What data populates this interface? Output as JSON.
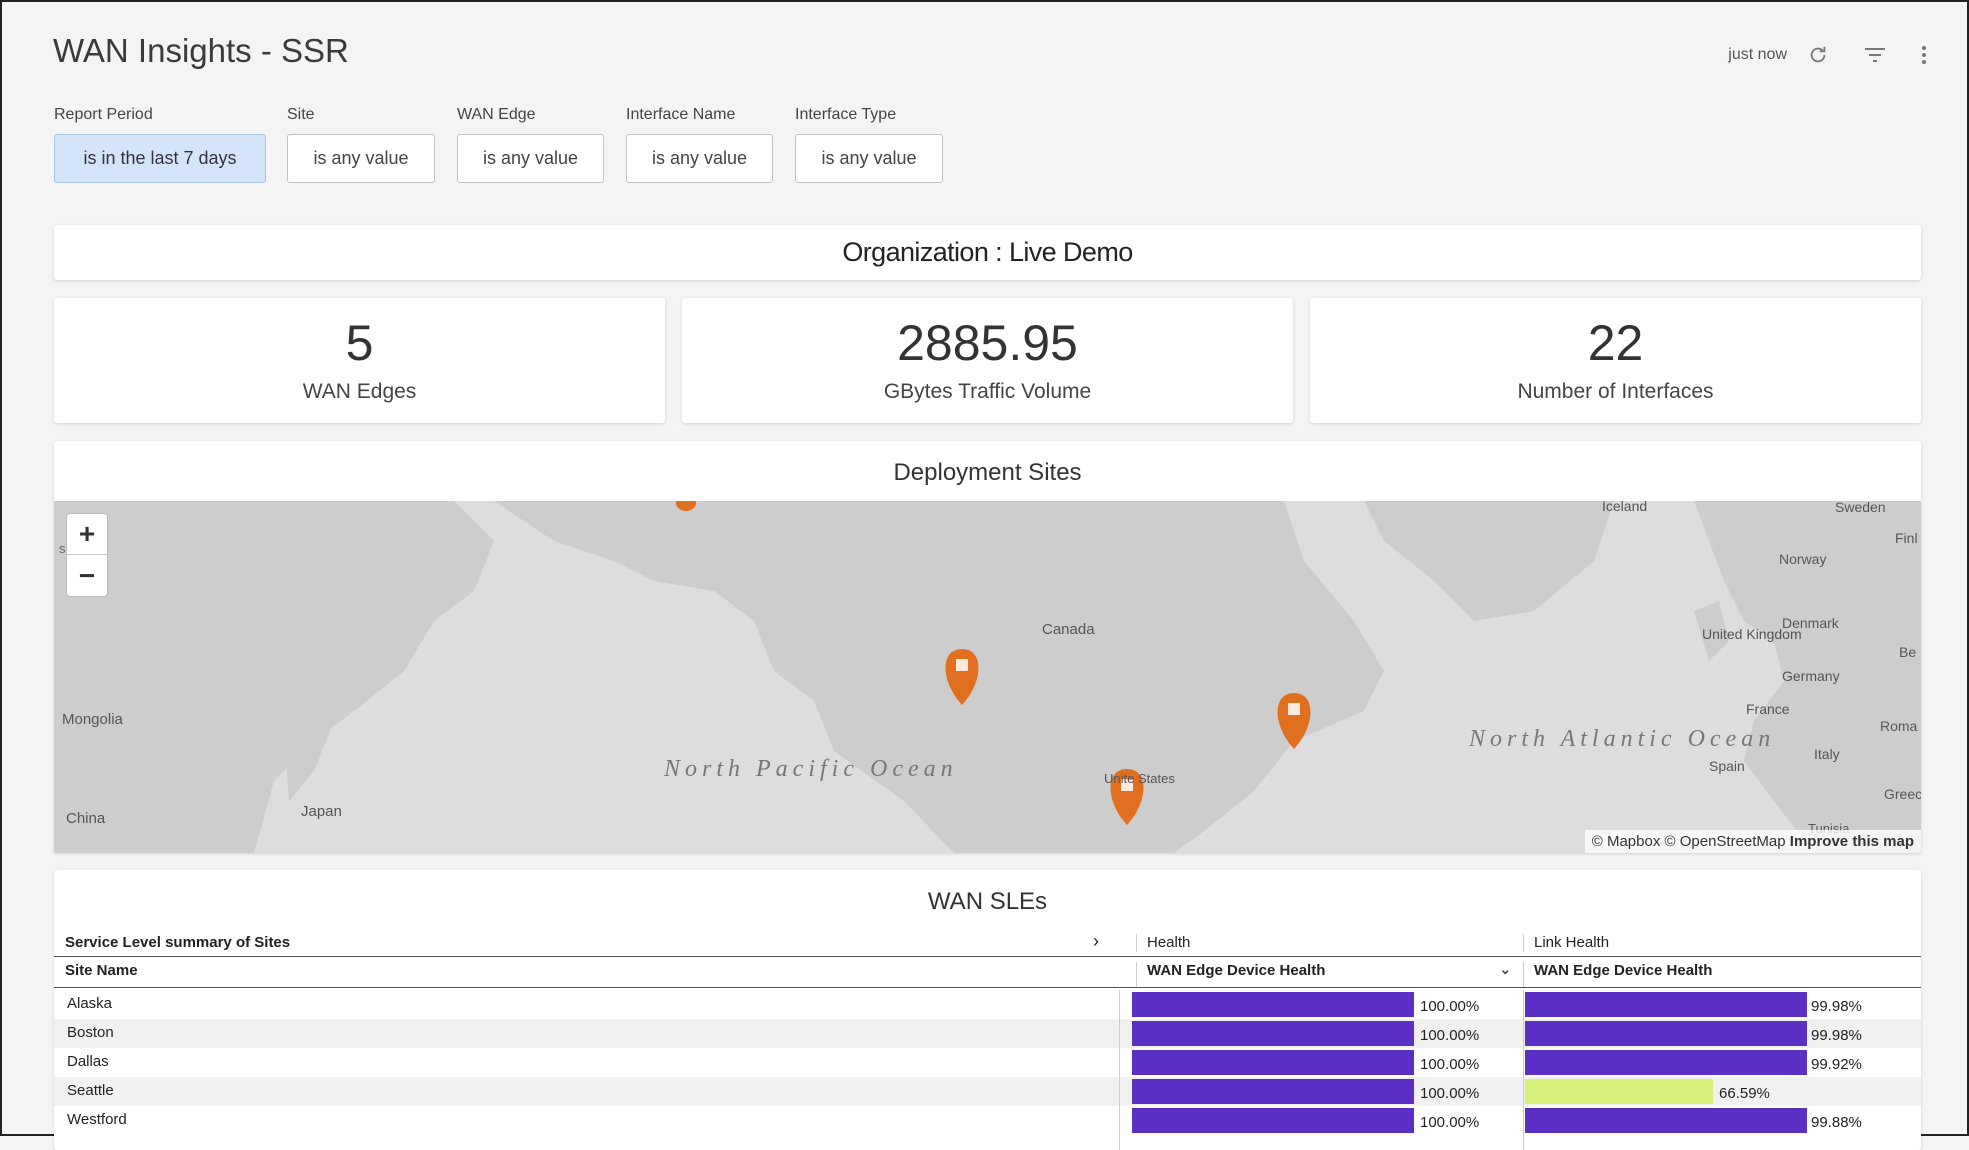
{
  "header": {
    "title": "WAN Insights - SSR",
    "timestamp": "just now"
  },
  "filters": [
    {
      "label": "Report Period",
      "value": "is in the last 7 days",
      "active": true
    },
    {
      "label": "Site",
      "value": "is any value",
      "active": false
    },
    {
      "label": "WAN Edge",
      "value": "is any value",
      "active": false
    },
    {
      "label": "Interface Name",
      "value": "is any value",
      "active": false
    },
    {
      "label": "Interface Type",
      "value": "is any value",
      "active": false
    }
  ],
  "org_banner": "Organization : Live Demo",
  "kpis": [
    {
      "value": "5",
      "label": "WAN Edges"
    },
    {
      "value": "2885.95",
      "label": "GBytes Traffic Volume"
    },
    {
      "value": "22",
      "label": "Number of Interfaces"
    }
  ],
  "map": {
    "title": "Deployment Sites",
    "zoom_in": "+",
    "zoom_out": "−",
    "attribution_text": "© Mapbox © OpenStreetMap",
    "attribution_link": "Improve this map",
    "labels": {
      "mongolia": "Mongolia",
      "china": "China",
      "japan": "Japan",
      "canada": "Canada",
      "iceland": "Iceland",
      "sweden": "Sweden",
      "norway": "Norway",
      "united_kingdom": "United Kingdom",
      "denmark": "Denmark",
      "germany": "Germany",
      "france": "France",
      "spain": "Spain",
      "italy": "Italy",
      "roma": "Roma",
      "north_pacific": "North Pacific Ocean",
      "north_atlantic": "North Atlantic Ocean",
      "fragment_si": "si",
      "fragment_fin": "Finl",
      "fragment_be": "Be",
      "fragment_gre": "Greec",
      "fragment_tu": "Tunisia",
      "fragment_us": "Unite States"
    },
    "colors": {
      "land": "#cdcdcd",
      "water": "#dddddd",
      "marker": "#e07020"
    }
  },
  "sle": {
    "title": "WAN SLEs",
    "summary_label": "Service Level summary of Sites",
    "group_health": "Health",
    "group_link_health": "Link Health",
    "col_site": "Site Name",
    "col_health_metric": "WAN Edge Device Health",
    "col_link_metric": "WAN Edge Device Health",
    "colors": {
      "good": "#5b2fc4",
      "warn": "#d6f07a"
    },
    "rows": [
      {
        "site": "Alaska",
        "health": 100.0,
        "health_label": "100.00%",
        "link": 99.98,
        "link_label": "99.98%"
      },
      {
        "site": "Boston",
        "health": 100.0,
        "health_label": "100.00%",
        "link": 99.98,
        "link_label": "99.98%"
      },
      {
        "site": "Dallas",
        "health": 100.0,
        "health_label": "100.00%",
        "link": 99.92,
        "link_label": "99.92%"
      },
      {
        "site": "Seattle",
        "health": 100.0,
        "health_label": "100.00%",
        "link": 66.59,
        "link_label": "66.59%"
      },
      {
        "site": "Westford",
        "health": 100.0,
        "health_label": "100.00%",
        "link": 99.88,
        "link_label": "99.88%"
      }
    ]
  }
}
